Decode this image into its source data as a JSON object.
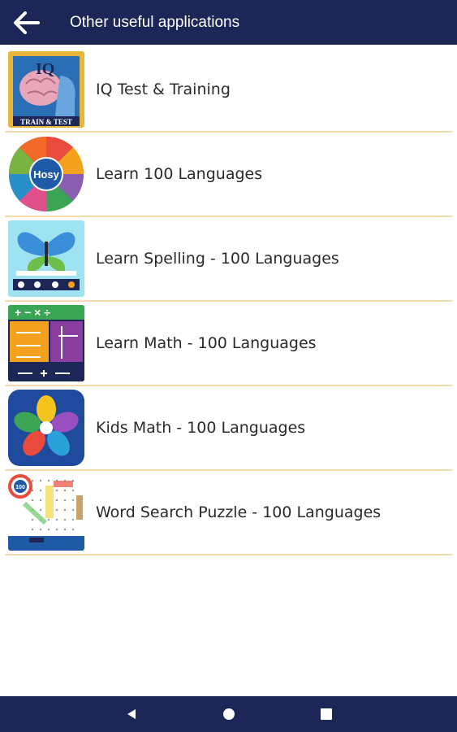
{
  "header": {
    "title": "Other useful applications",
    "back_icon": "arrow-back-icon"
  },
  "apps": [
    {
      "label": "IQ Test & Training",
      "icon": "iq-brain-icon",
      "icon_text": "IQ",
      "icon_caption": "TRAIN & TEST"
    },
    {
      "label": "Learn 100 Languages",
      "icon": "language-wheel-icon",
      "icon_text": "Hosy"
    },
    {
      "label": "Learn Spelling - 100 Languages",
      "icon": "butterfly-spelling-icon"
    },
    {
      "label": "Learn Math - 100 Languages",
      "icon": "math-operations-icon"
    },
    {
      "label": "Kids Math - 100 Languages",
      "icon": "kids-math-flower-icon"
    },
    {
      "label": "Word Search Puzzle - 100 Languages",
      "icon": "word-search-grid-icon",
      "icon_text": "100"
    }
  ],
  "nav": {
    "back": "nav-back-icon",
    "home": "nav-home-icon",
    "recents": "nav-recents-icon"
  },
  "colors": {
    "bar": "#1c2657",
    "divider": "#f2dcae",
    "text": "#2a2a2a"
  }
}
